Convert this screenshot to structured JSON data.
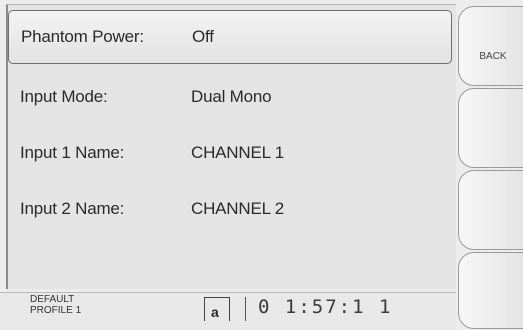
{
  "settings": {
    "rows": [
      {
        "label": "Phantom Power:",
        "value": "Off"
      },
      {
        "label": "Input Mode:",
        "value": "Dual Mono"
      },
      {
        "label": "Input 1 Name:",
        "value": "CHANNEL 1"
      },
      {
        "label": "Input 2 Name:",
        "value": "CHANNEL 2"
      }
    ]
  },
  "softkeys": {
    "back_label": "BACK"
  },
  "status": {
    "profile_line1": "DEFAULT",
    "profile_line2": "PROFILE 1",
    "lock_glyph": "a",
    "timecode": "0 1:57:1 1"
  }
}
